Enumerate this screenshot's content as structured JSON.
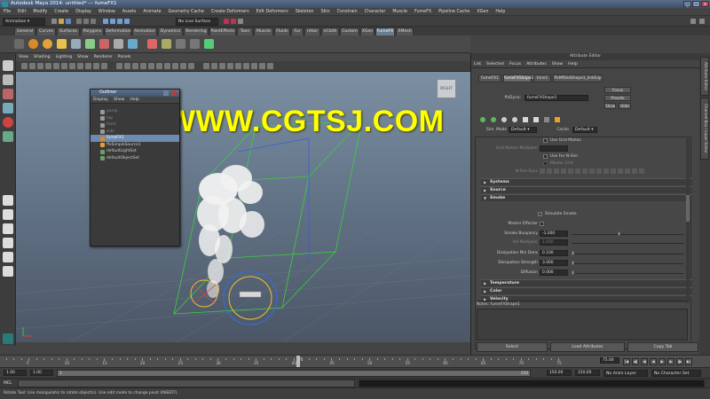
{
  "window": {
    "title": "Autodesk Maya 2014: untitled*   ---   fumeFX1"
  },
  "menu": [
    "File",
    "Edit",
    "Modify",
    "Create",
    "Display",
    "Window",
    "Assets",
    "Animate",
    "Geometry Cache",
    "Create Deformers",
    "Edit Deformers",
    "Skeleton",
    "Skin",
    "Constrain",
    "Character",
    "Muscle",
    "FumeFX",
    "Pipeline Cache",
    "XGen",
    "Help"
  ],
  "status_line": {
    "menu_set": "Animation",
    "live_surface": "No Live Surface"
  },
  "shelf_tabs": [
    "General",
    "Curves",
    "Surfaces",
    "Polygons",
    "Deformation",
    "Animation",
    "Dynamics",
    "Rendering",
    "PaintEffects",
    "Toon",
    "Muscle",
    "Fluids",
    "Fur",
    "nHair",
    "nCloth",
    "Custom",
    "XGen",
    "FumeFX",
    "XMesh"
  ],
  "shelf_active_tab": "FumeFX",
  "panel_menu": [
    "View",
    "Shading",
    "Lighting",
    "Show",
    "Renderer",
    "Panels"
  ],
  "viewcube": {
    "label": "RIGHT"
  },
  "watermark": "WWW.CGTSJ.COM",
  "outliner": {
    "title": "Outliner",
    "menu": [
      "Display",
      "Show",
      "Help"
    ],
    "items": [
      {
        "label": "persp",
        "dim": true,
        "selected": false
      },
      {
        "label": "top",
        "dim": true,
        "selected": false
      },
      {
        "label": "front",
        "dim": true,
        "selected": false
      },
      {
        "label": "side",
        "dim": true,
        "selected": false
      },
      {
        "label": "fumeFX1",
        "dim": false,
        "selected": true
      },
      {
        "label": "ffxSimpleSource1",
        "dim": false,
        "selected": false
      },
      {
        "label": "defaultLightSet",
        "dim": false,
        "selected": false
      },
      {
        "label": "defaultObjectSet",
        "dim": false,
        "selected": false
      }
    ]
  },
  "attribute_editor": {
    "title": "Attribute Editor",
    "menu": [
      "List",
      "Selected",
      "Focus",
      "Attributes",
      "Show",
      "Help"
    ],
    "tabs": [
      "fumeFX1",
      "fumeFXShape1",
      "time1",
      "ffxMRVolShape1_linkExp"
    ],
    "active_tab": "fumeFXShape1",
    "node_label": "ffxDyna:",
    "node_value": "fumeFXShape1",
    "focus_btn": "Focus",
    "presets_btn": "Presets",
    "show_btn": "Show",
    "hide_btn": "Hide",
    "sim_mode_label": "Sim. Mode",
    "sim_mode_value": "Default",
    "cache_label": "Cache",
    "cache_value": "Default",
    "grid_motion": "Use Grid Motion",
    "grid_motion_mult": "Grid Motion Multiplier",
    "use_for_nsim": "Use For N-Sim",
    "master_grid": "Master Grid",
    "n_sim_sync": "N-Sim Sync",
    "sections": [
      "Systems",
      "Source",
      "Smoke",
      "Temperature",
      "Color",
      "Velocity"
    ],
    "simulate_smoke_label": "Simulate Smoke",
    "master_effector_label": "Master Effector",
    "smoke_buoyancy_label": "Smoke Buoyancy",
    "smoke_buoyancy": "-1.000",
    "vel_multiplier_label": "Vel Multiplier",
    "vel_multiplier": "1.000",
    "dissipation_min_label": "Dissipation Min Dens",
    "dissipation_min": "0.100",
    "dissipation_strength_label": "Dissipation Strength",
    "dissipation_strength": "3.000",
    "diffusion_label": "Diffusion",
    "diffusion": "0.000",
    "notes_label": "Notes: fumeFXShape1",
    "select_btn": "Select",
    "load_attributes_btn": "Load Attributes",
    "copy_tab_btn": "Copy Tab"
  },
  "side_tabs": [
    "Attribute Editor",
    "Channel Box / Layer Editor"
  ],
  "timeline": {
    "ticks": [
      "5",
      "10",
      "15",
      "20",
      "25",
      "30",
      "35",
      "40",
      "45",
      "50",
      "55",
      "60",
      "65",
      "70",
      "75"
    ],
    "current_frame": "75",
    "current_frame_field": "75.00"
  },
  "range": {
    "start": "1.00",
    "start2": "1.00",
    "range_start": "1",
    "range_end": "150",
    "end": "150.00",
    "end2": "150.00",
    "anim_layer": "No Anim Layer",
    "char_set": "No Character Set"
  },
  "command_line": {
    "mode": "MEL"
  },
  "help_line": "Rotate Tool: Use manipulator to rotate object(s). Use edit mode to change pivot (INSERT)."
}
